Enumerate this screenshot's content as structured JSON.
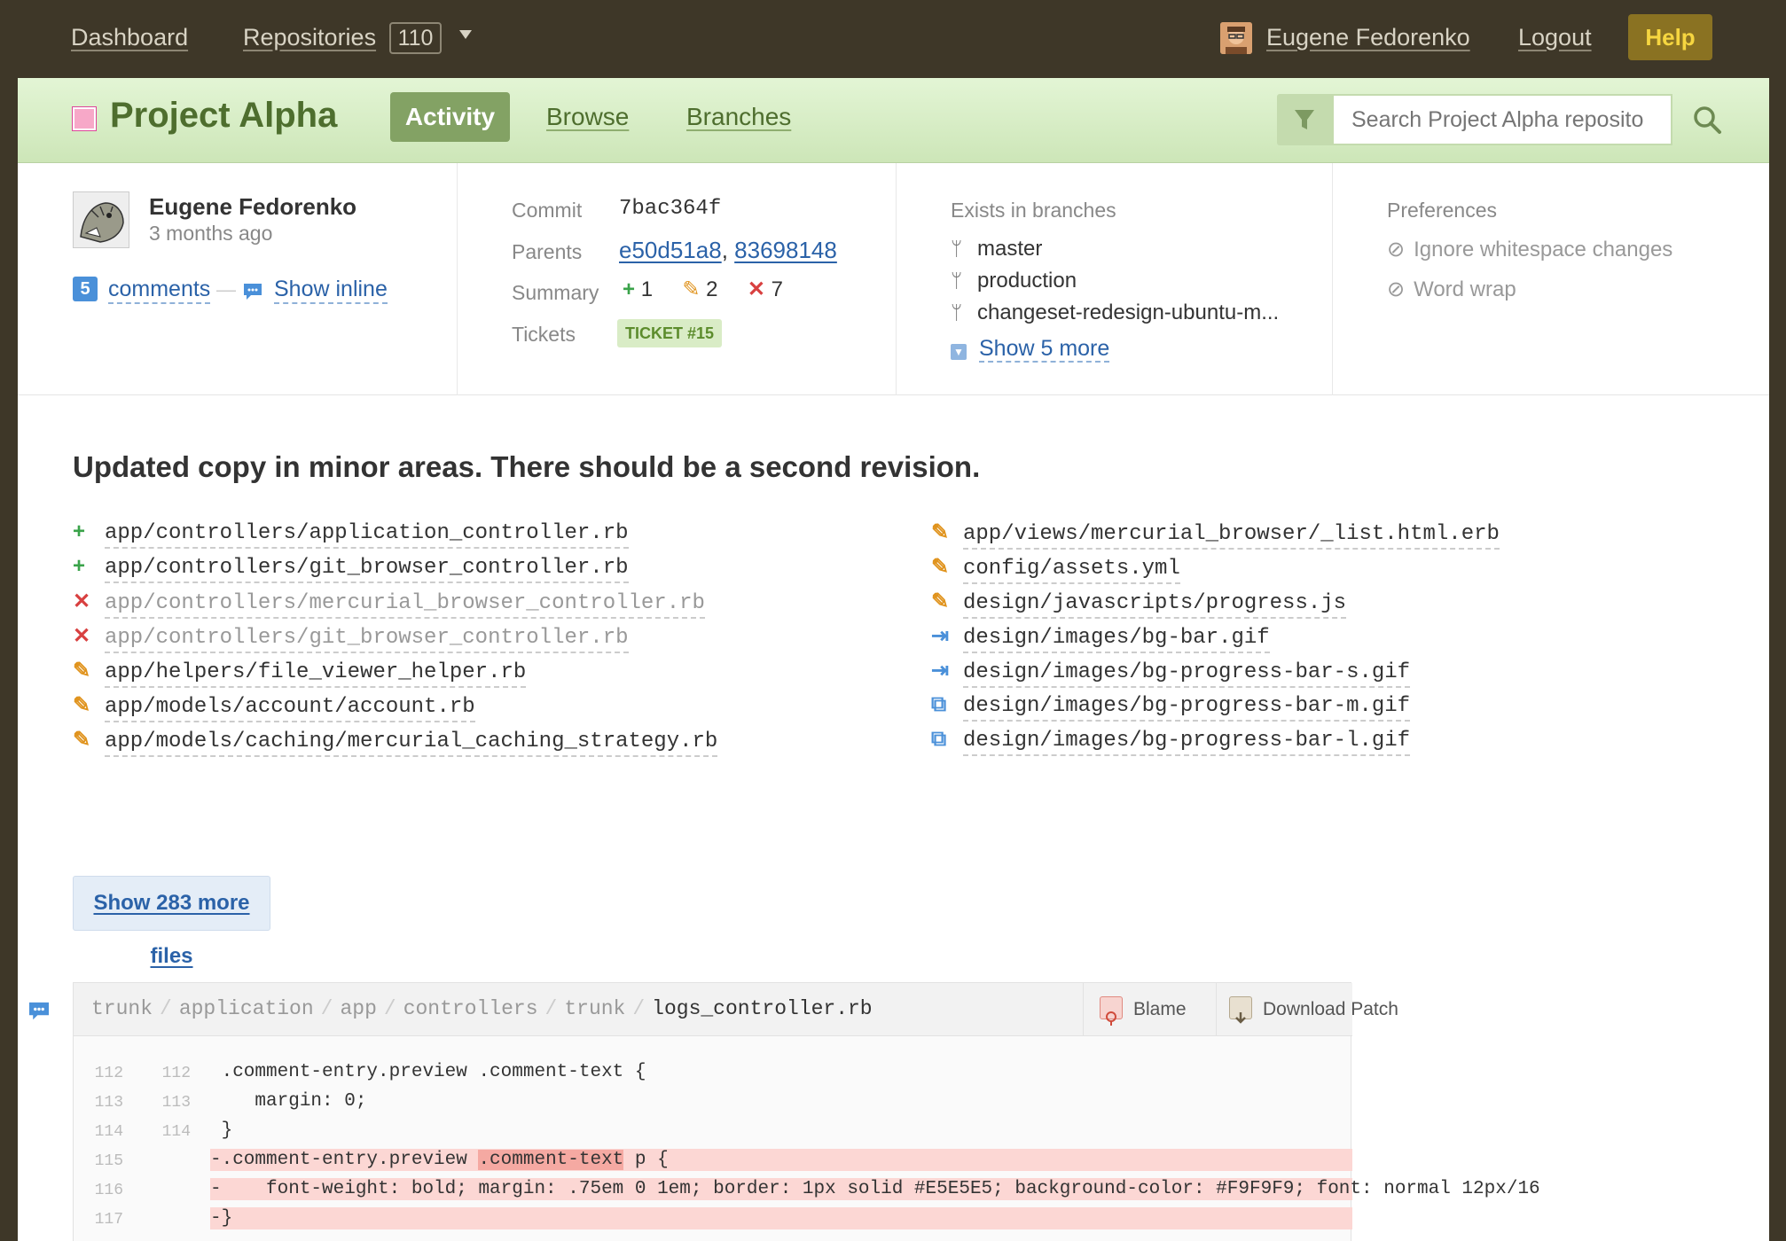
{
  "topbar": {
    "dashboard": "Dashboard",
    "repositories": "Repositories",
    "repo_count": "110",
    "user_name": "Eugene Fedorenko",
    "logout": "Logout",
    "help": "Help"
  },
  "project": {
    "title": "Project Alpha",
    "tabs": [
      "Activity",
      "Browse",
      "Branches"
    ],
    "search_placeholder": "Search Project Alpha reposito"
  },
  "commit": {
    "author": "Eugene Fedorenko",
    "time": "3 months ago",
    "comments_count": "5",
    "comments_label": "comments",
    "dash": "—",
    "show_inline": "Show inline",
    "commit_label": "Commit",
    "commit_hash": "7bac364f",
    "parents_label": "Parents",
    "parents": [
      "e50d51a8",
      "83698148"
    ],
    "parents_sep": ",",
    "summary_label": "Summary",
    "summary": {
      "added": "1",
      "modified": "2",
      "deleted": "7"
    },
    "tickets_label": "Tickets",
    "ticket": "TICKET #15",
    "branches_label": "Exists in branches",
    "branches": [
      "master",
      "production",
      "changeset-redesign-ubuntu-m..."
    ],
    "show_more_branches": "Show 5 more",
    "preferences_label": "Preferences",
    "preferences": [
      "Ignore whitespace changes",
      "Word wrap"
    ]
  },
  "message": "Updated copy in minor areas. There should be a second revision.",
  "files_left": [
    {
      "status": "added",
      "path": "app/controllers/application_controller.rb"
    },
    {
      "status": "added",
      "path": "app/controllers/git_browser_controller.rb"
    },
    {
      "status": "deleted",
      "path": "app/controllers/mercurial_browser_controller.rb"
    },
    {
      "status": "deleted",
      "path": "app/controllers/git_browser_controller.rb"
    },
    {
      "status": "modified",
      "path": "app/helpers/file_viewer_helper.rb"
    },
    {
      "status": "modified",
      "path": "app/models/account/account.rb"
    },
    {
      "status": "modified",
      "path": "app/models/caching/mercurial_caching_strategy.rb"
    }
  ],
  "files_right": [
    {
      "status": "modified",
      "path": "app/views/mercurial_browser/_list.html.erb"
    },
    {
      "status": "modified",
      "path": "config/assets.yml"
    },
    {
      "status": "modified",
      "path": "design/javascripts/progress.js"
    },
    {
      "status": "moved",
      "path": "design/images/bg-bar.gif"
    },
    {
      "status": "moved",
      "path": "design/images/bg-progress-bar-s.gif"
    },
    {
      "status": "copied",
      "path": "design/images/bg-progress-bar-m.gif"
    },
    {
      "status": "copied",
      "path": "design/images/bg-progress-bar-l.gif"
    }
  ],
  "show_more_files": "Show 283 more files",
  "code": {
    "breadcrumb": [
      "trunk",
      "application",
      "app",
      "controllers",
      "trunk"
    ],
    "breadcrumb_sep": "/",
    "file": "logs_controller.rb",
    "blame": "Blame",
    "download_patch": "Download Patch",
    "lines": [
      {
        "old": "112",
        "new": "112",
        "type": "ctx",
        "text": " .comment-entry.preview .comment-text {"
      },
      {
        "old": "113",
        "new": "113",
        "type": "ctx",
        "text": "    margin: 0;"
      },
      {
        "old": "114",
        "new": "114",
        "type": "ctx",
        "text": " }"
      },
      {
        "old": "115",
        "new": "",
        "type": "del",
        "pre": "-.comment-entry.preview ",
        "hl": ".comment-text",
        "post": " p {"
      },
      {
        "old": "116",
        "new": "",
        "type": "del",
        "text": "-    font-weight: bold; margin: .75em 0 1em; border: 1px solid #E5E5E5; background-color: #F9F9F9; font: normal 12px/16"
      },
      {
        "old": "117",
        "new": "",
        "type": "del",
        "text": "-}"
      }
    ]
  },
  "colors": {
    "topbar": "#3e3728",
    "project_green": "#4e6e2e",
    "link": "#2b62a8",
    "added": "#3aa34a",
    "modified": "#e0931d",
    "deleted": "#d84040",
    "moved": "#4a90d9"
  }
}
